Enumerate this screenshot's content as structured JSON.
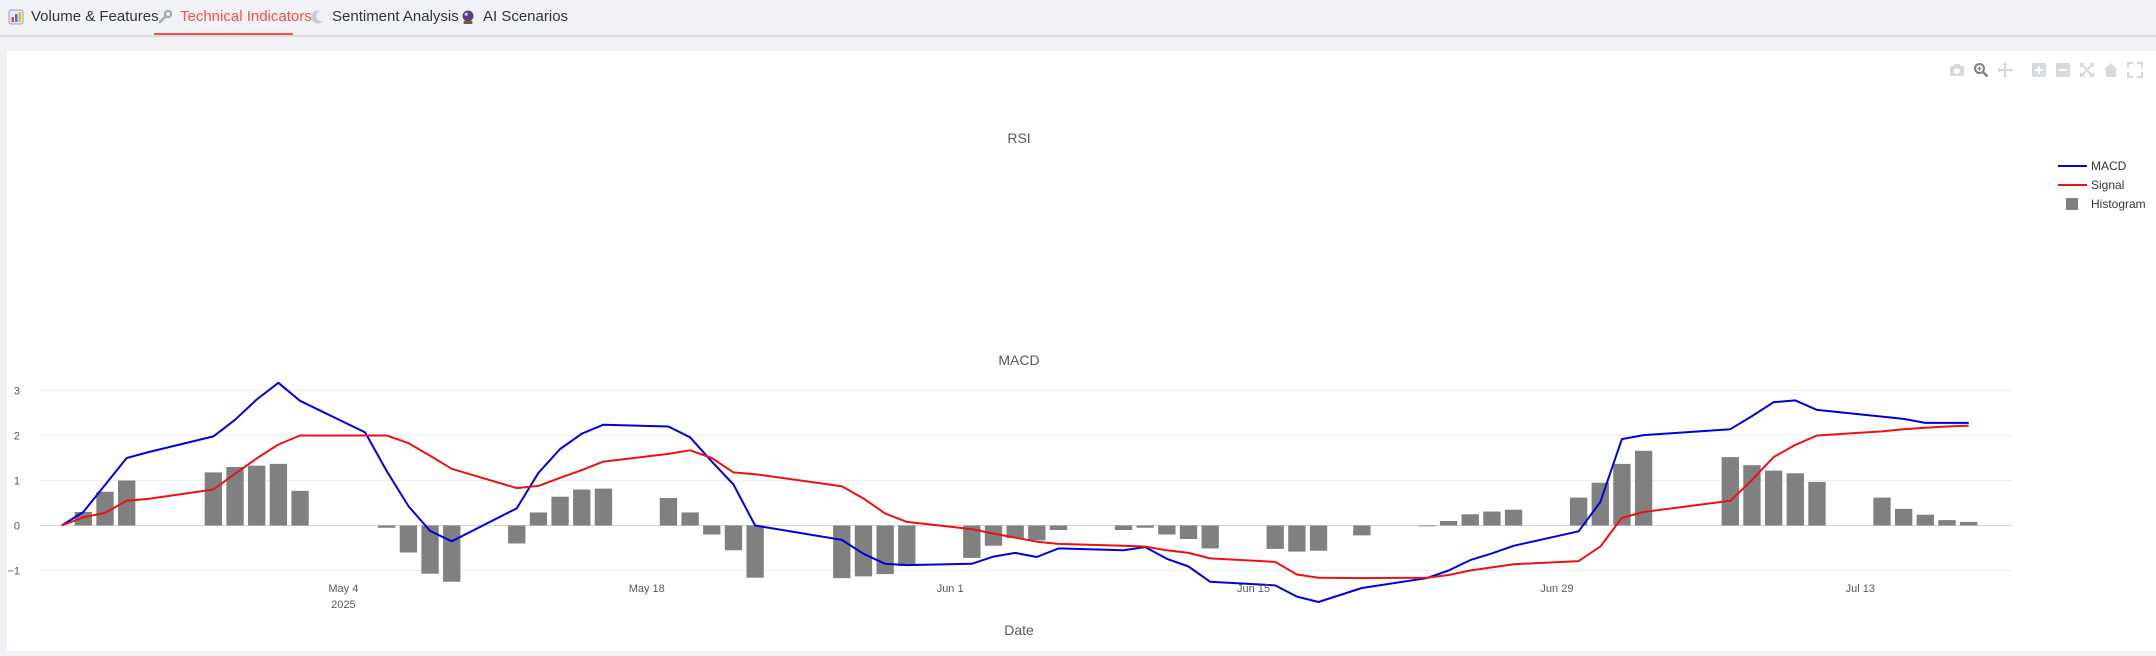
{
  "tabs": [
    {
      "label": "Volume & Features",
      "icon": "bar-chart-icon",
      "active": false
    },
    {
      "label": "Technical Indicators",
      "icon": "wrench-icon",
      "active": true
    },
    {
      "label": "Sentiment Analysis",
      "icon": "moon-icon",
      "active": false
    },
    {
      "label": "AI Scenarios",
      "icon": "crystal-ball-icon",
      "active": false
    }
  ],
  "modebar": [
    "camera-icon",
    "zoom-icon",
    "pan-icon",
    "zoom-in-icon",
    "zoom-out-icon",
    "autoscale-icon",
    "reset-axes-icon",
    "fullscreen-icon"
  ],
  "colors": {
    "accent": "#ff4b4b",
    "macd": "#0000dd",
    "signal": "#ee1111",
    "histogram": "#808080"
  },
  "chart_data": [
    {
      "type": "line",
      "title": "RSI",
      "series": []
    },
    {
      "type": "bar",
      "title": "MACD",
      "xlabel": "Date",
      "ylabel": "",
      "ylim": [
        -1.9,
        3.3
      ],
      "grid": true,
      "legend": "top-right",
      "x_ticks": [
        "May 4",
        "May 18",
        "Jun 1",
        "Jun 15",
        "Jun 29",
        "Jul 13"
      ],
      "x_tick_sub": "2025",
      "y_ticks": [
        "3",
        "2",
        "1",
        "0",
        "−1"
      ],
      "x": [
        "2025-04-21",
        "2025-04-22",
        "2025-04-23",
        "2025-04-24",
        "2025-04-25",
        "2025-04-28",
        "2025-04-29",
        "2025-04-30",
        "2025-05-01",
        "2025-05-02",
        "2025-05-05",
        "2025-05-06",
        "2025-05-07",
        "2025-05-08",
        "2025-05-09",
        "2025-05-12",
        "2025-05-13",
        "2025-05-14",
        "2025-05-15",
        "2025-05-16",
        "2025-05-19",
        "2025-05-20",
        "2025-05-21",
        "2025-05-22",
        "2025-05-23",
        "2025-05-27",
        "2025-05-28",
        "2025-05-29",
        "2025-05-30",
        "2025-06-02",
        "2025-06-03",
        "2025-06-04",
        "2025-06-05",
        "2025-06-06",
        "2025-06-09",
        "2025-06-10",
        "2025-06-11",
        "2025-06-12",
        "2025-06-13",
        "2025-06-16",
        "2025-06-17",
        "2025-06-18",
        "2025-06-20",
        "2025-06-23",
        "2025-06-24",
        "2025-06-25",
        "2025-06-26",
        "2025-06-27",
        "2025-06-30",
        "2025-07-01",
        "2025-07-02",
        "2025-07-03",
        "2025-07-07",
        "2025-07-08",
        "2025-07-09",
        "2025-07-10",
        "2025-07-11",
        "2025-07-14",
        "2025-07-15",
        "2025-07-16",
        "2025-07-17",
        "2025-07-18"
      ],
      "series": [
        {
          "name": "MACD",
          "values": [
            0.0,
            0.3,
            0.9,
            1.5,
            1.63,
            1.98,
            2.35,
            2.8,
            3.17,
            2.77,
            2.07,
            1.21,
            0.43,
            -0.12,
            -0.35,
            0.38,
            1.17,
            1.7,
            2.04,
            2.24,
            2.2,
            1.96,
            1.42,
            0.91,
            0.0,
            -0.32,
            -0.63,
            -0.85,
            -0.88,
            -0.85,
            -0.69,
            -0.61,
            -0.7,
            -0.51,
            -0.55,
            -0.48,
            -0.74,
            -0.91,
            -1.25,
            -1.33,
            -1.58,
            -1.7,
            -1.39,
            -1.17,
            -1.0,
            -0.77,
            -0.62,
            -0.45,
            -0.13,
            0.52,
            1.92,
            2.01,
            2.14,
            2.43,
            2.74,
            2.78,
            2.57,
            2.42,
            2.37,
            2.28,
            2.28,
            2.28
          ]
        },
        {
          "name": "Signal",
          "values": [
            0.0,
            0.18,
            0.28,
            0.55,
            0.59,
            0.8,
            1.15,
            1.49,
            1.8,
            2.0,
            2.0,
            2.0,
            1.83,
            1.55,
            1.26,
            0.83,
            0.88,
            1.06,
            1.23,
            1.42,
            1.59,
            1.67,
            1.5,
            1.18,
            1.14,
            0.87,
            0.6,
            0.27,
            0.08,
            -0.08,
            -0.18,
            -0.27,
            -0.36,
            -0.41,
            -0.45,
            -0.47,
            -0.55,
            -0.61,
            -0.73,
            -0.81,
            -1.09,
            -1.16,
            -1.17,
            -1.16,
            -1.1,
            -1.0,
            -0.93,
            -0.86,
            -0.79,
            -0.47,
            0.17,
            0.3,
            0.55,
            1.01,
            1.52,
            1.79,
            2.0,
            2.09,
            2.14,
            2.17,
            2.2,
            2.22
          ]
        },
        {
          "name": "Histogram",
          "values": [
            0.0,
            0.3,
            0.75,
            1.0,
            null,
            1.18,
            1.3,
            1.33,
            1.37,
            0.77,
            null,
            -0.05,
            -0.6,
            -1.07,
            -1.25,
            -0.4,
            0.29,
            0.64,
            0.8,
            0.82,
            0.61,
            0.29,
            -0.2,
            -0.55,
            -1.16,
            -1.17,
            -1.13,
            -1.08,
            -0.9,
            -0.72,
            -0.45,
            -0.28,
            -0.33,
            -0.1,
            -0.1,
            -0.05,
            -0.2,
            -0.3,
            -0.51,
            -0.52,
            -0.58,
            -0.56,
            -0.22,
            -0.01,
            0.1,
            0.25,
            0.31,
            0.35,
            0.62,
            0.95,
            1.37,
            1.66,
            1.52,
            1.34,
            1.22,
            1.16,
            0.97,
            0.62,
            0.37,
            0.24,
            0.12,
            0.08
          ]
        }
      ]
    }
  ]
}
